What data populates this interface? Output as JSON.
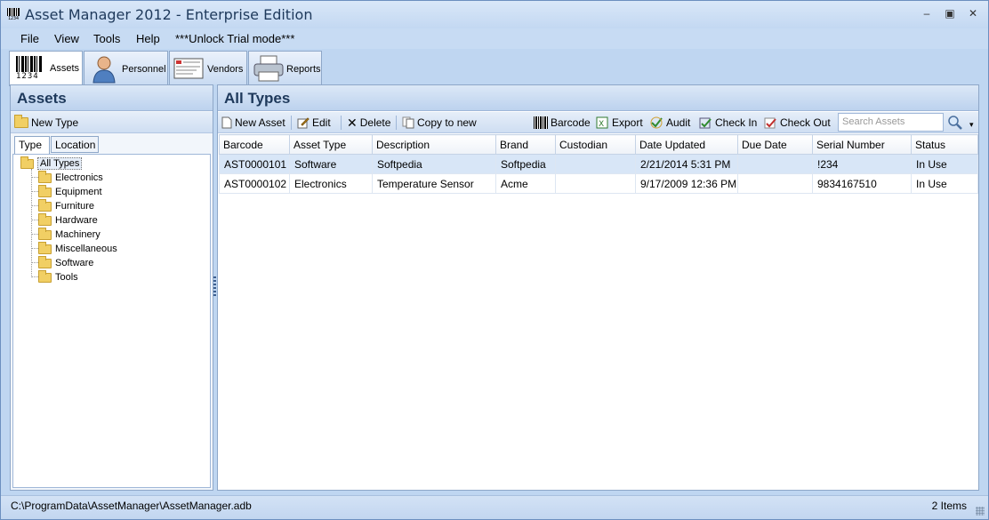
{
  "window": {
    "title": "Asset Manager 2012 - Enterprise Edition",
    "icon": "barcode-icon",
    "icon_digits": "1234"
  },
  "menu": [
    "File",
    "View",
    "Tools",
    "Help",
    "***Unlock Trial mode***"
  ],
  "modules": [
    {
      "label": "Assets",
      "icon": "barcode-icon",
      "digits": "1234"
    },
    {
      "label": "Personnel",
      "icon": "person-icon"
    },
    {
      "label": "Vendors",
      "icon": "document-icon"
    },
    {
      "label": "Reports",
      "icon": "printer-icon"
    }
  ],
  "left": {
    "title": "Assets",
    "new_type": "New Type",
    "tabs": [
      "Type",
      "Location"
    ],
    "tree_root": "All Types",
    "tree_items": [
      "Electronics",
      "Equipment",
      "Furniture",
      "Hardware",
      "Machinery",
      "Miscellaneous",
      "Software",
      "Tools"
    ]
  },
  "right": {
    "title": "All Types",
    "toolbar": {
      "new_asset": "New Asset",
      "edit": "Edit",
      "delete": "Delete",
      "copy": "Copy to new",
      "barcode": "Barcode",
      "export": "Export",
      "audit": "Audit",
      "check_in": "Check In",
      "check_out": "Check Out",
      "search_placeholder": "Search Assets"
    },
    "columns": [
      "Barcode",
      "Asset Type",
      "Description",
      "Brand",
      "Custodian",
      "Date Updated",
      "Due Date",
      "Serial Number",
      "Status"
    ],
    "rows": [
      [
        "AST0000101",
        "Software",
        "Softpedia",
        "Softpedia",
        "",
        "2/21/2014 5:31 PM",
        "",
        "!234",
        "In Use"
      ],
      [
        "AST0000102",
        "Electronics",
        "Temperature Sensor",
        "Acme",
        "",
        "9/17/2009 12:36 PM",
        "",
        "9834167510",
        "In Use"
      ]
    ]
  },
  "status": {
    "path": "C:\\ProgramData\\AssetManager\\AssetManager.adb",
    "count": "2 Items"
  },
  "colors": {
    "accent": "#1e395b",
    "frame": "#bfd6f1",
    "selected_row": "#d8e6f7"
  }
}
